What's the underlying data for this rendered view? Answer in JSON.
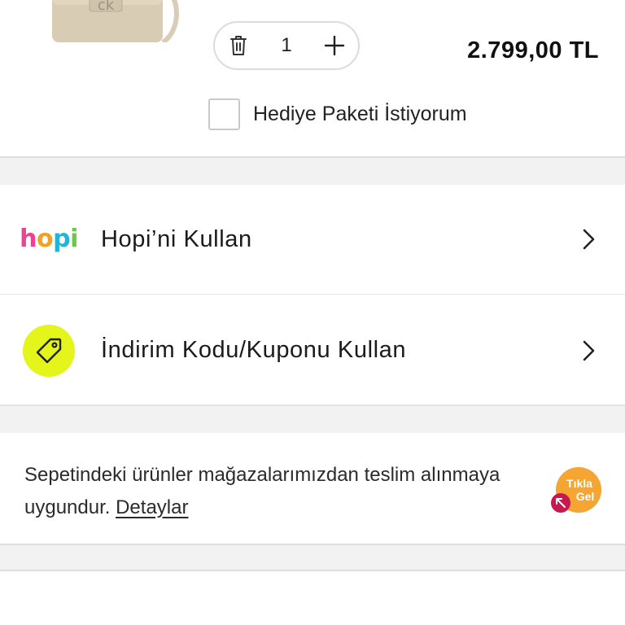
{
  "product": {
    "quantity": "1",
    "price": "2.799,00 TL",
    "gift_label": "Hediye Paketi İstiyorum"
  },
  "options": {
    "hopi_logo": "hopi",
    "hopi_label": "Hopi’ni Kullan",
    "coupon_label": "İndirim Kodu/Kuponu Kullan"
  },
  "info": {
    "text": "Sepetindeki ürünler mağazalarımızdan teslim alınmaya uygundur.",
    "link": "Detaylar",
    "badge_line1": "Tıkla",
    "badge_line2": "Gel"
  },
  "colors": {
    "coupon_accent": "#e3f51b",
    "badge_orange": "#f5a531",
    "badge_pointer": "#c8184f"
  },
  "icons": [
    "trash-icon",
    "plus-icon",
    "chevron-right-icon",
    "tag-icon"
  ]
}
